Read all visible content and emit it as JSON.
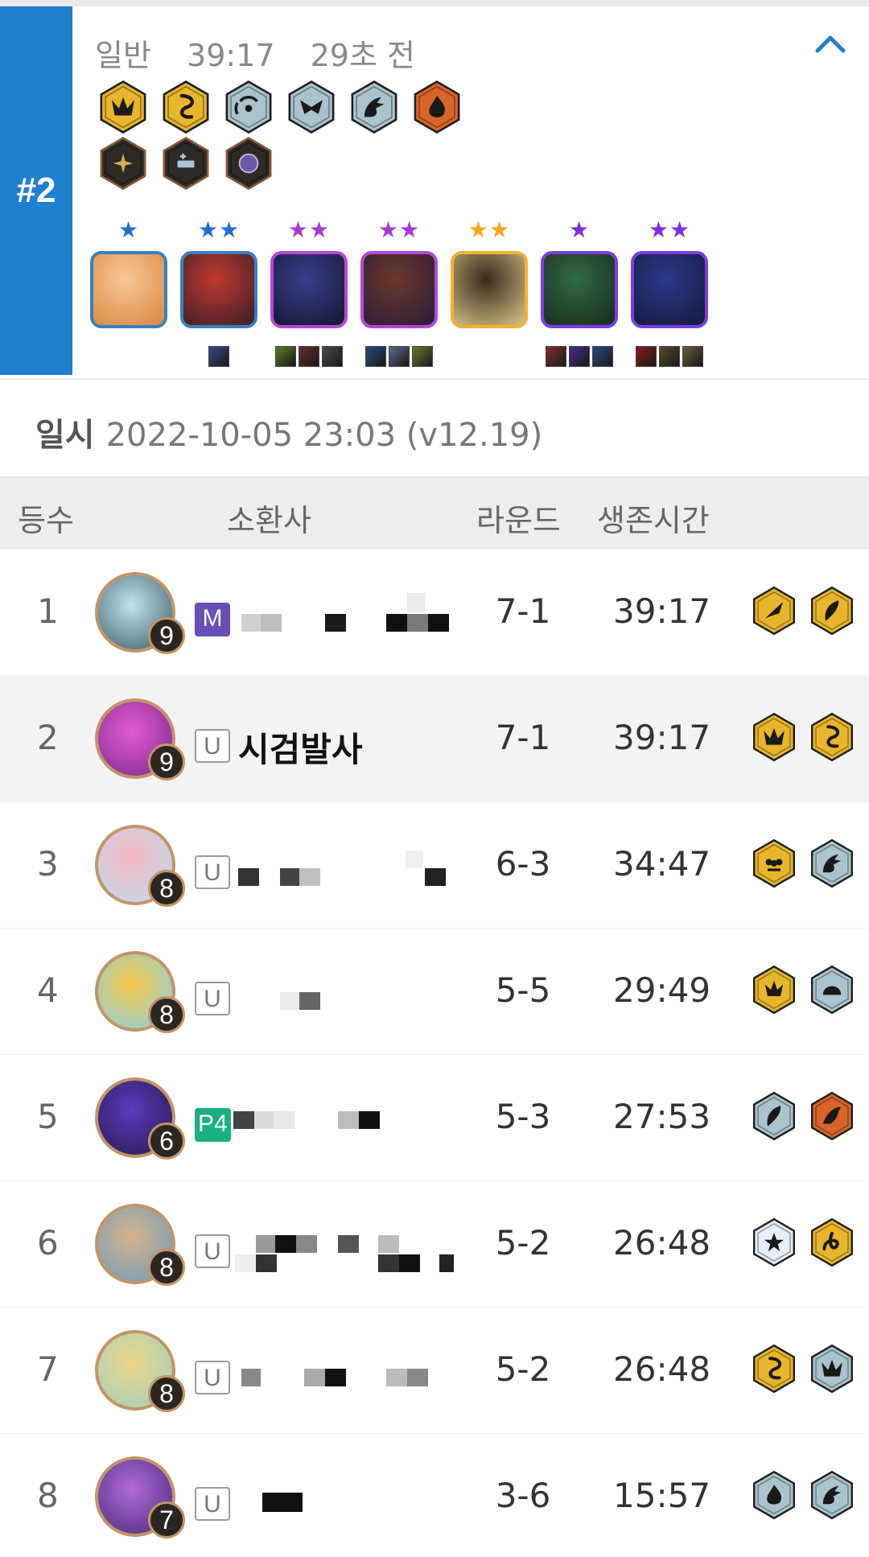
{
  "match": {
    "placement": "#2",
    "mode": "일반",
    "duration": "39:17",
    "ago": "29초 전",
    "traits_row1": [
      {
        "icon": "crown-trait-icon",
        "tier": "gold"
      },
      {
        "icon": "swirl-trait-icon",
        "tier": "gold"
      },
      {
        "icon": "signal-trait-icon",
        "tier": "silver"
      },
      {
        "icon": "mask-trait-icon",
        "tier": "silver"
      },
      {
        "icon": "dragon-trait-icon",
        "tier": "silver"
      },
      {
        "icon": "flame-trait-icon",
        "tier": "bronze"
      }
    ],
    "traits_row2": [
      {
        "icon": "sparkle-trait-icon",
        "tier": "inactive"
      },
      {
        "icon": "plus-trait-icon",
        "tier": "inactive"
      },
      {
        "icon": "orb-trait-icon",
        "tier": "inactive"
      }
    ],
    "units": [
      {
        "stars": "★",
        "star_color": "#1f6fd1",
        "border": "#3a7fc0",
        "palette": [
          "#f6c79a",
          "#d9883d"
        ],
        "items": []
      },
      {
        "stars": "★★",
        "star_color": "#1f6fd1",
        "border": "#3a7fc0",
        "palette": [
          "#c0382b",
          "#3a1f2a"
        ],
        "items": [
          "#3b4a8a"
        ]
      },
      {
        "stars": "★★",
        "star_color": "#a63ad6",
        "border": "#b548d8",
        "palette": [
          "#3a3f8a",
          "#151530"
        ],
        "items": [
          "#5c7d2a",
          "#6b2a2a",
          "#4a4a4a"
        ]
      },
      {
        "stars": "★★",
        "star_color": "#a63ad6",
        "border": "#b548d8",
        "palette": [
          "#6b3a2a",
          "#2a1a3a"
        ],
        "items": [
          "#2a4a7a",
          "#5a6a8a",
          "#6a7a2a"
        ]
      },
      {
        "stars": "★★",
        "star_color": "#f2a81c",
        "border": "#f2b233",
        "palette": [
          "#3a2a1a",
          "#d9c38a"
        ],
        "items": []
      },
      {
        "stars": "★",
        "star_color": "#7b2fe0",
        "border": "#7b3fe0",
        "palette": [
          "#2f6a4a",
          "#1a2a1a"
        ],
        "items": [
          "#8a2a2a",
          "#4a2a8a",
          "#2a4a8a"
        ]
      },
      {
        "stars": "★★",
        "star_color": "#7b2fe0",
        "border": "#7b3fe0",
        "palette": [
          "#2a3a8a",
          "#121a3a"
        ],
        "items": [
          "#8a1a1a",
          "#5a4a2a",
          "#6a5a3a"
        ]
      }
    ]
  },
  "date": {
    "label": "일시",
    "value": "2022-10-05 23:03 (v12.19)"
  },
  "table": {
    "headers": {
      "rank": "등수",
      "summoner": "소환사",
      "round": "라운드",
      "survival": "생존시간"
    },
    "rows": [
      {
        "rank": "1",
        "level": "9",
        "badge": "M",
        "badge_type": "m",
        "name": "",
        "round": "7-1",
        "time": "39:17",
        "avatar": [
          "#bfe4ef",
          "#3b5a66"
        ],
        "traits": [
          {
            "icon": "blade-trait-icon",
            "tier": "gold"
          },
          {
            "icon": "feather-trait-icon",
            "tier": "gold"
          }
        ]
      },
      {
        "rank": "2",
        "level": "9",
        "badge": "U",
        "badge_type": "u",
        "name": "시검발사",
        "round": "7-1",
        "time": "39:17",
        "avatar": [
          "#e45ad0",
          "#7a2a8a"
        ],
        "traits": [
          {
            "icon": "crown-trait-icon",
            "tier": "gold"
          },
          {
            "icon": "swirl-trait-icon",
            "tier": "gold"
          }
        ]
      },
      {
        "rank": "3",
        "level": "8",
        "badge": "U",
        "badge_type": "u",
        "name": "",
        "round": "6-3",
        "time": "34:47",
        "avatar": [
          "#f4b4c2",
          "#bfe0f0"
        ],
        "traits": [
          {
            "icon": "flower-trait-icon",
            "tier": "gold"
          },
          {
            "icon": "dragon-trait-icon",
            "tier": "silver"
          }
        ]
      },
      {
        "rank": "4",
        "level": "8",
        "badge": "U",
        "badge_type": "u",
        "name": "",
        "round": "5-5",
        "time": "29:49",
        "avatar": [
          "#f6c84a",
          "#8ad0e8"
        ],
        "traits": [
          {
            "icon": "lotus-trait-icon",
            "tier": "gold"
          },
          {
            "icon": "shell-trait-icon",
            "tier": "silver"
          }
        ]
      },
      {
        "rank": "5",
        "level": "6",
        "badge": "P4",
        "badge_type": "p",
        "name": "",
        "round": "5-3",
        "time": "27:53",
        "avatar": [
          "#5a3ac0",
          "#2a1a4a"
        ],
        "traits": [
          {
            "icon": "feather-trait-icon",
            "tier": "silver"
          },
          {
            "icon": "wing-trait-icon",
            "tier": "bronze"
          }
        ]
      },
      {
        "rank": "6",
        "level": "8",
        "badge": "U",
        "badge_type": "u",
        "name": "",
        "round": "5-2",
        "time": "26:48",
        "avatar": [
          "#d8b48a",
          "#6a9ac0"
        ],
        "traits": [
          {
            "icon": "star-trait-icon",
            "tier": "prismatic"
          },
          {
            "icon": "serpent-trait-icon",
            "tier": "gold"
          }
        ]
      },
      {
        "rank": "7",
        "level": "8",
        "badge": "U",
        "badge_type": "u",
        "name": "",
        "round": "5-2",
        "time": "26:48",
        "avatar": [
          "#f0d58a",
          "#9ad0c0"
        ],
        "traits": [
          {
            "icon": "swirl-trait-icon",
            "tier": "gold"
          },
          {
            "icon": "crown-trait-icon",
            "tier": "silver"
          }
        ]
      },
      {
        "rank": "8",
        "level": "7",
        "badge": "U",
        "badge_type": "u",
        "name": "",
        "round": "3-6",
        "time": "15:57",
        "avatar": [
          "#b06ad8",
          "#4a2a7a"
        ],
        "traits": [
          {
            "icon": "flame-trait-icon",
            "tier": "silver"
          },
          {
            "icon": "dragon-trait-icon",
            "tier": "silver"
          }
        ]
      }
    ]
  },
  "colors": {
    "place_bar": "#1f7fd0",
    "gold": "#e7b62c",
    "silver": "#a9c4cc",
    "bronze": "#d9642a",
    "inactive": "#2f2a26",
    "prismatic": "#e6eef6"
  }
}
